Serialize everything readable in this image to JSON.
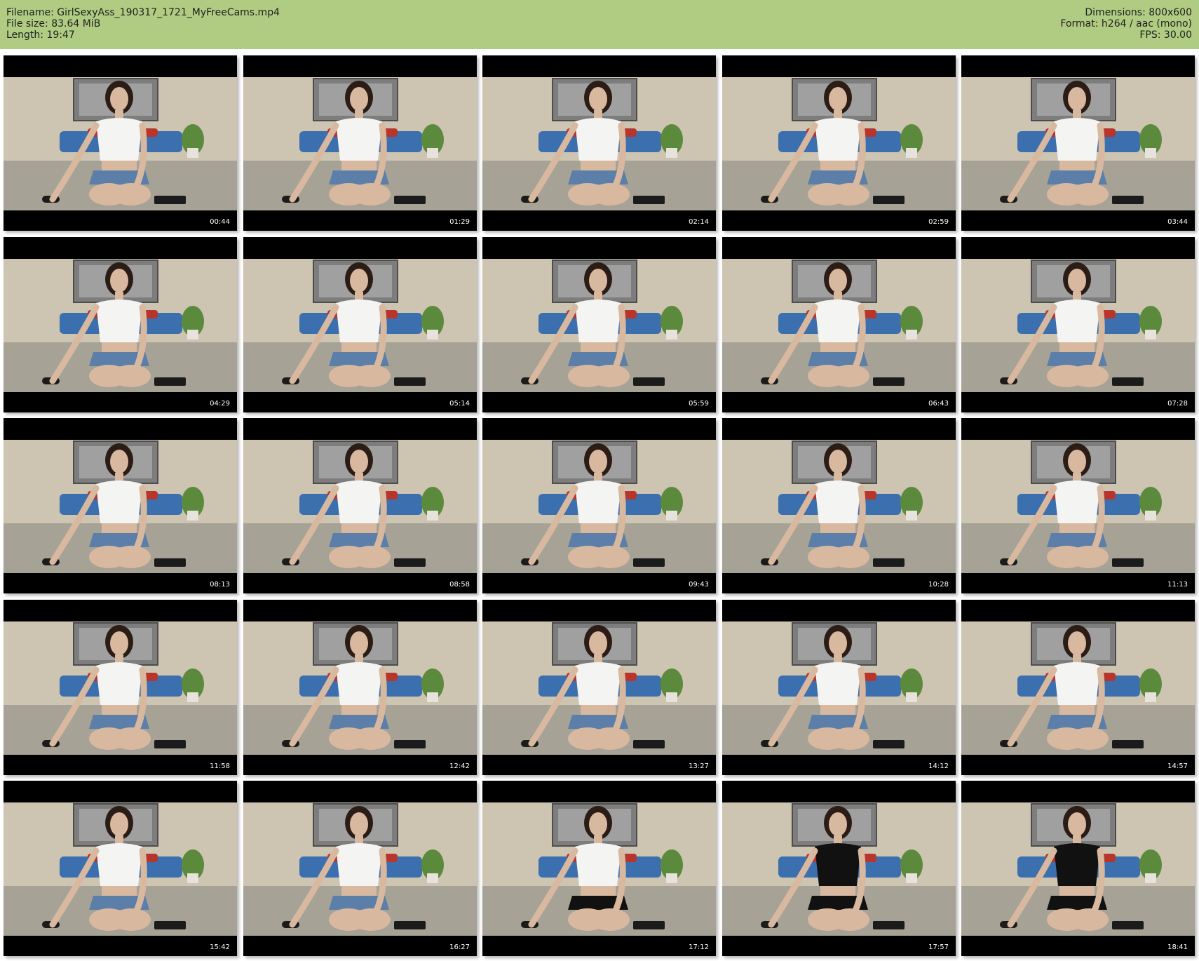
{
  "info": {
    "filename": "Filename: GirlSexyAss_190317_1721_MyFreeCams.mp4",
    "filesize": "File size: 83.64 MiB",
    "length": "Length: 19:47",
    "dimensions": "Dimensions: 800x600",
    "format": "Format: h264 / aac (mono)",
    "fps": "FPS: 30.00"
  },
  "colors": {
    "header_bg": "#b0cc82",
    "frame_letterbox": "#000000",
    "wall": "#cdc4b2",
    "blanket": "#a7a296",
    "pillows": "#3c6fae",
    "shirt": "#f4f4f2",
    "shorts": "#5b7fa8",
    "lingerie": "#111111"
  },
  "thumbnails": [
    {
      "timestamp": "00:44",
      "outfit": "shirt"
    },
    {
      "timestamp": "01:29",
      "outfit": "shirt"
    },
    {
      "timestamp": "02:14",
      "outfit": "shirt"
    },
    {
      "timestamp": "02:59",
      "outfit": "shirt"
    },
    {
      "timestamp": "03:44",
      "outfit": "shirt"
    },
    {
      "timestamp": "04:29",
      "outfit": "shirt"
    },
    {
      "timestamp": "05:14",
      "outfit": "shirt"
    },
    {
      "timestamp": "05:59",
      "outfit": "shirt"
    },
    {
      "timestamp": "06:43",
      "outfit": "shirt"
    },
    {
      "timestamp": "07:28",
      "outfit": "shirt"
    },
    {
      "timestamp": "08:13",
      "outfit": "shirt"
    },
    {
      "timestamp": "08:58",
      "outfit": "shirt"
    },
    {
      "timestamp": "09:43",
      "outfit": "shirt"
    },
    {
      "timestamp": "10:28",
      "outfit": "shirt"
    },
    {
      "timestamp": "11:13",
      "outfit": "shirt"
    },
    {
      "timestamp": "11:58",
      "outfit": "shirt"
    },
    {
      "timestamp": "12:42",
      "outfit": "shirt"
    },
    {
      "timestamp": "13:27",
      "outfit": "shirt"
    },
    {
      "timestamp": "14:12",
      "outfit": "shirt"
    },
    {
      "timestamp": "14:57",
      "outfit": "shirt"
    },
    {
      "timestamp": "15:42",
      "outfit": "shirt"
    },
    {
      "timestamp": "16:27",
      "outfit": "shirt"
    },
    {
      "timestamp": "17:12",
      "outfit": "shirt-lingerie"
    },
    {
      "timestamp": "17:57",
      "outfit": "lingerie"
    },
    {
      "timestamp": "18:41",
      "outfit": "lingerie"
    }
  ]
}
